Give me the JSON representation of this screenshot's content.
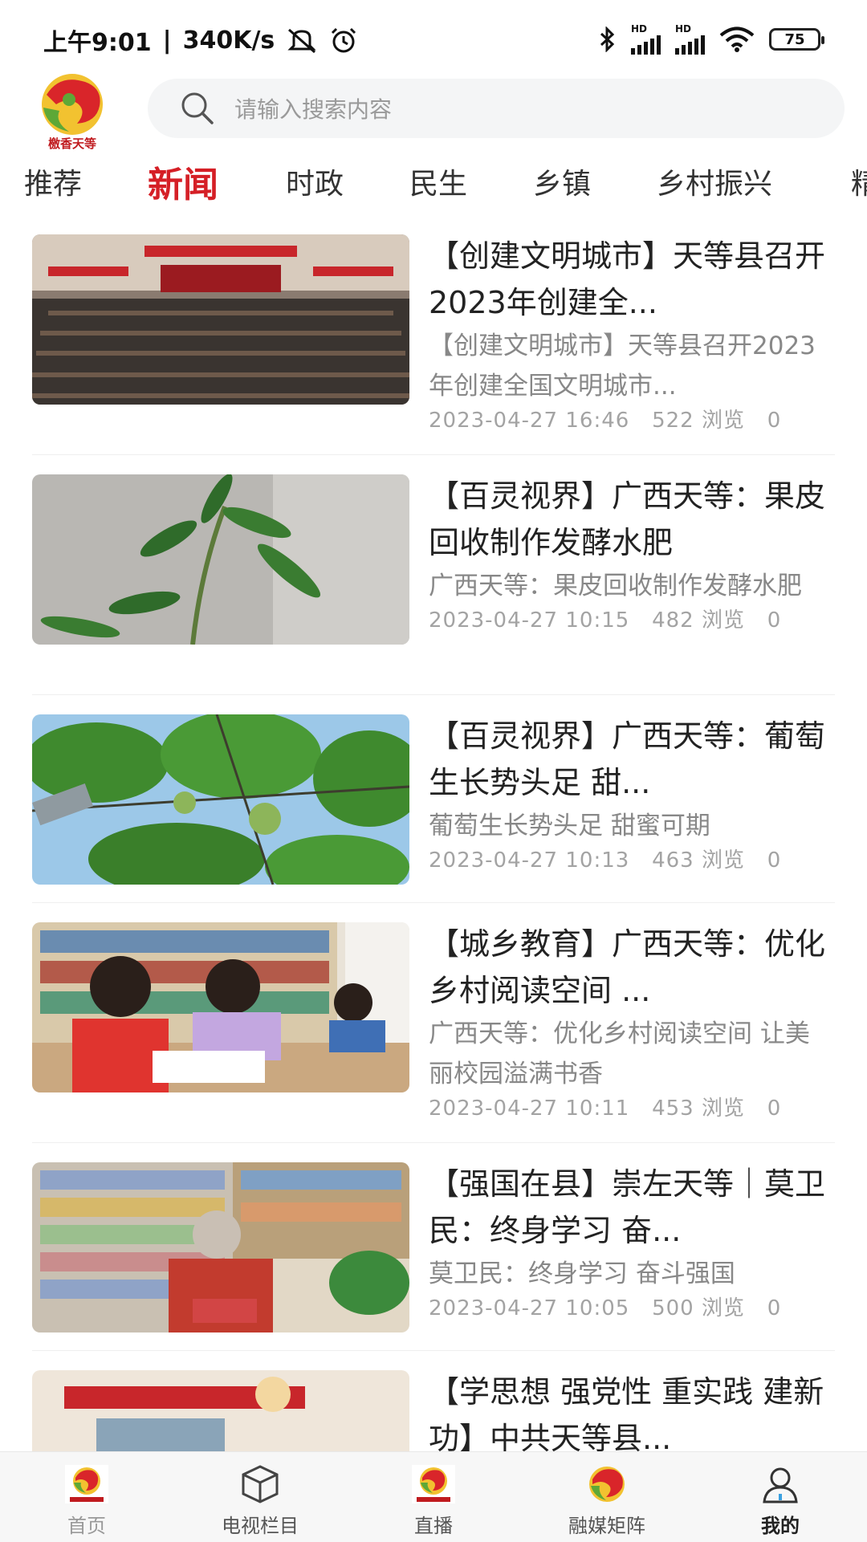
{
  "status": {
    "time": "上午9:01",
    "speed": "340K/s",
    "hd1": "HD",
    "hd2": "HD",
    "battery": "75"
  },
  "search": {
    "placeholder": "请输入搜索内容"
  },
  "tabs": [
    "推荐",
    "新闻",
    "时政",
    "民生",
    "乡镇",
    "乡村振兴",
    "精"
  ],
  "active_tab": "新闻",
  "articles": [
    {
      "title": "【创建文明城市】天等县召开2023年创建全...",
      "desc": "【创建文明城市】天等县召开2023年创建全国文明城市...",
      "date": "2023-04-27 16:46",
      "views": "522 浏览",
      "comments": "0"
    },
    {
      "title": "【百灵视界】广西天等：果皮回收制作发酵水肥",
      "desc": "广西天等：果皮回收制作发酵水肥",
      "date": "2023-04-27 10:15",
      "views": "482 浏览",
      "comments": "0"
    },
    {
      "title": "【百灵视界】广西天等：葡萄生长势头足 甜...",
      "desc": "葡萄生长势头足 甜蜜可期",
      "date": "2023-04-27 10:13",
      "views": "463 浏览",
      "comments": "0"
    },
    {
      "title": "【城乡教育】广西天等：优化乡村阅读空间 ...",
      "desc": "广西天等：优化乡村阅读空间 让美丽校园溢满书香",
      "date": "2023-04-27 10:11",
      "views": "453 浏览",
      "comments": "0"
    },
    {
      "title": "【强国在县】崇左天等｜莫卫民：终身学习 奋...",
      "desc": "莫卫民：终身学习 奋斗强国",
      "date": "2023-04-27 10:05",
      "views": "500 浏览",
      "comments": "0"
    },
    {
      "title": "【学思想 强党性 重实践 建新功】中共天等县...",
      "desc": "",
      "date": "",
      "views": "",
      "comments": ""
    }
  ],
  "bottom_nav": [
    "首页",
    "电视栏目",
    "直播",
    "融媒矩阵",
    "我的"
  ],
  "colors": {
    "accent": "#d51f26",
    "logo_red": "#d9252a",
    "logo_yellow": "#f2c230",
    "logo_green": "#5ea837"
  }
}
